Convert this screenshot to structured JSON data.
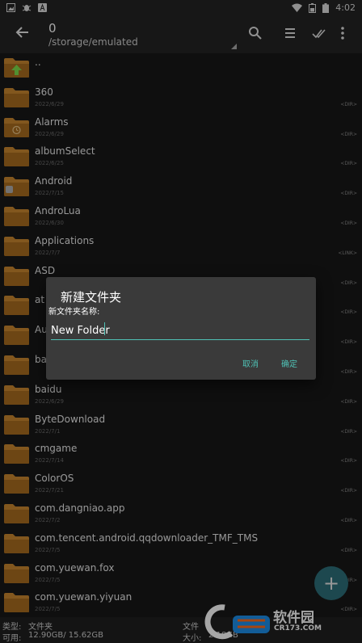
{
  "status_bar": {
    "time": "4:02",
    "left_icons": [
      "image-icon",
      "bug-icon",
      "a-icon"
    ],
    "right_icons": [
      "wifi-icon",
      "battery-half-icon",
      "battery-icon"
    ]
  },
  "toolbar": {
    "title": "0",
    "path": "/storage/emulated",
    "icons": [
      "back-arrow-icon",
      "search-icon",
      "list-icon",
      "double-check-icon",
      "more-vertical-icon"
    ]
  },
  "colors": {
    "folder": "#c8862e",
    "accent": "#4fc1b5",
    "background": "#171717"
  },
  "files": [
    {
      "name": "..",
      "date": "",
      "tag": "",
      "icon": "up-arrow"
    },
    {
      "name": "360",
      "date": "2022/6/29",
      "tag": "<DIR>",
      "icon": ""
    },
    {
      "name": "Alarms",
      "date": "2022/6/29",
      "tag": "<DIR>",
      "icon": "clock"
    },
    {
      "name": "albumSelect",
      "date": "2022/6/25",
      "tag": "<DIR>",
      "icon": ""
    },
    {
      "name": "Android",
      "date": "2022/7/15",
      "tag": "<DIR>",
      "icon": "android"
    },
    {
      "name": "AndroLua",
      "date": "2022/6/30",
      "tag": "<DIR>",
      "icon": ""
    },
    {
      "name": "Applications",
      "date": "2022/7/7",
      "tag": "<LINK>",
      "icon": ""
    },
    {
      "name": "ASD",
      "date": "",
      "tag": "<DIR>",
      "icon": ""
    },
    {
      "name": "at",
      "date": "",
      "tag": "<DIR>",
      "icon": ""
    },
    {
      "name": "Au",
      "date": "",
      "tag": "<DIR>",
      "icon": ""
    },
    {
      "name": "ba",
      "date": "",
      "tag": "<DIR>",
      "icon": ""
    },
    {
      "name": "baidu",
      "date": "2022/6/29",
      "tag": "<DIR>",
      "icon": ""
    },
    {
      "name": "ByteDownload",
      "date": "2022/7/1",
      "tag": "<DIR>",
      "icon": ""
    },
    {
      "name": "cmgame",
      "date": "2022/7/14",
      "tag": "<DIR>",
      "icon": ""
    },
    {
      "name": "ColorOS",
      "date": "2022/7/21",
      "tag": "<DIR>",
      "icon": ""
    },
    {
      "name": "com.dangniao.app",
      "date": "2022/7/2",
      "tag": "<DIR>",
      "icon": ""
    },
    {
      "name": "com.tencent.android.qqdownloader_TMF_TMS",
      "date": "2022/7/5",
      "tag": "<DIR>",
      "icon": ""
    },
    {
      "name": "com.yuewan.fox",
      "date": "2022/7/5",
      "tag": "<DIR>",
      "icon": ""
    },
    {
      "name": "com.yuewan.yiyuan",
      "date": "2022/7/5",
      "tag": "<DIR>",
      "icon": ""
    }
  ],
  "footer": {
    "type_label": "类型:",
    "type_value": "文件夹",
    "avail_label": "可用:",
    "avail_value": "12.90GB/ 15.62GB",
    "right_top": "文件",
    "size_label": "大小:",
    "size_value": "2.18GB"
  },
  "dialog": {
    "title": "新建文件夹",
    "label": "新文件夹名称:",
    "input_value": "New Folder",
    "cancel": "取消",
    "confirm": "确定"
  },
  "fab": {
    "label": "+"
  },
  "watermark": {
    "text": "软件园",
    "url": "CR173.COM"
  }
}
